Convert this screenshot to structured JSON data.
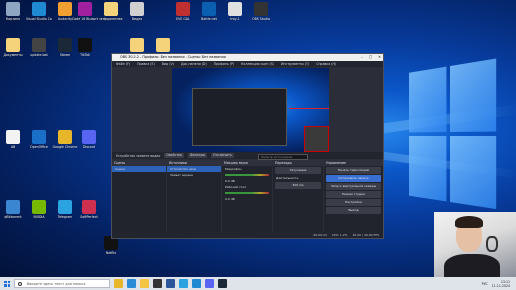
{
  "desktop_icons": [
    {
      "label": "Корзина",
      "color": "#8fa6c2"
    },
    {
      "label": "Visual Studio Code",
      "color": "#1f8ad2"
    },
    {
      "label": "Audacity",
      "color": "#f0a030"
    },
    {
      "label": "Code 16 Blueprints",
      "color": "#a020a0"
    },
    {
      "label": "информатика",
      "color": "#f4d37b"
    },
    {
      "label": "Видео",
      "color": "#d0d0d0"
    },
    {
      "label": "EVE GAL",
      "color": "#c03030"
    },
    {
      "label": "Battle.net",
      "color": "#0a5fb0"
    },
    {
      "label": "tray-1",
      "color": "#e0e0e0"
    },
    {
      "label": "OBS Studio",
      "color": "#333"
    },
    {
      "label": "Документы",
      "color": "#f4d37b"
    },
    {
      "label": "update.bat",
      "color": "#444"
    },
    {
      "label": "Steam",
      "color": "#1b2838"
    },
    {
      "label": "TikTok",
      "color": "#111"
    },
    {
      "label": "Файлы Дарио",
      "color": "#f4d37b"
    },
    {
      "label": "Папка",
      "color": "#f4d37b"
    },
    {
      "label": "AB",
      "color": "#f3f3f3"
    },
    {
      "label": "OpenOffice",
      "color": "#1a70c8"
    },
    {
      "label": "Google Chrome",
      "color": "#e8b62a"
    },
    {
      "label": "Discord",
      "color": "#5865f2"
    },
    {
      "label": "qBittorrent",
      "color": "#3a86d0"
    },
    {
      "label": "NVIDIA",
      "color": "#76b900"
    },
    {
      "label": "Telegram",
      "color": "#2aa3e0"
    },
    {
      "label": "SoftPerfect",
      "color": "#d03050"
    },
    {
      "label": "Netflix",
      "color": "#111"
    }
  ],
  "obs": {
    "title": "OBS 30.2.2 - Профиль: Без названия - Сцены: Без названия",
    "menu": [
      "Файл (F)",
      "Правка (E)",
      "Вид (V)",
      "Док-панели (D)",
      "Профиль (P)",
      "Коллекция сцен (S)",
      "Инструменты (T)",
      "Справка (H)"
    ],
    "toolbar": [
      "Устройство захвата видео",
      "Свойства",
      "Фильтры",
      "Отключить"
    ],
    "filter_placeholder": "Фильтр источников",
    "scenes_title": "Сцены",
    "scenes": [
      "Сцена"
    ],
    "sources_title": "Источники",
    "sources": [
      "Устройство захв",
      "Захват экрана"
    ],
    "mixer_title": "Микшер звука",
    "mixer": [
      {
        "name": "Микрофон",
        "level": "0.0 dB"
      },
      {
        "name": "Рабочий стол",
        "level": "0.0 dB"
      }
    ],
    "transitions_title": "Переходы",
    "transition": "Затухание",
    "duration_label": "Длительность",
    "duration_value": "300 ms",
    "controls_title": "Управление",
    "controls": [
      "Начать трансляцию",
      "Остановить запись",
      "Запуск виртуальной камеры",
      "Режим студии",
      "Настройки",
      "Выход"
    ],
    "status": {
      "rec": "00:00:13",
      "cpu": "CPU: 1.2%",
      "fps": "30.00 / 30.00 FPS"
    }
  },
  "taskbar": {
    "search_placeholder": "Введите здесь текст для поиска",
    "apps": [
      {
        "name": "chrome",
        "color": "#e8b62a"
      },
      {
        "name": "edge",
        "color": "#2a8bd6"
      },
      {
        "name": "explorer",
        "color": "#f4c542"
      },
      {
        "name": "obs",
        "color": "#333"
      },
      {
        "name": "word",
        "color": "#2b579a"
      },
      {
        "name": "telegram",
        "color": "#2aa3e0"
      },
      {
        "name": "vscode",
        "color": "#1f8ad2"
      },
      {
        "name": "discord",
        "color": "#5865f2"
      },
      {
        "name": "steam",
        "color": "#1b2838"
      }
    ],
    "lang": "РУС",
    "time": "13:11",
    "date": "11.11.2024"
  }
}
